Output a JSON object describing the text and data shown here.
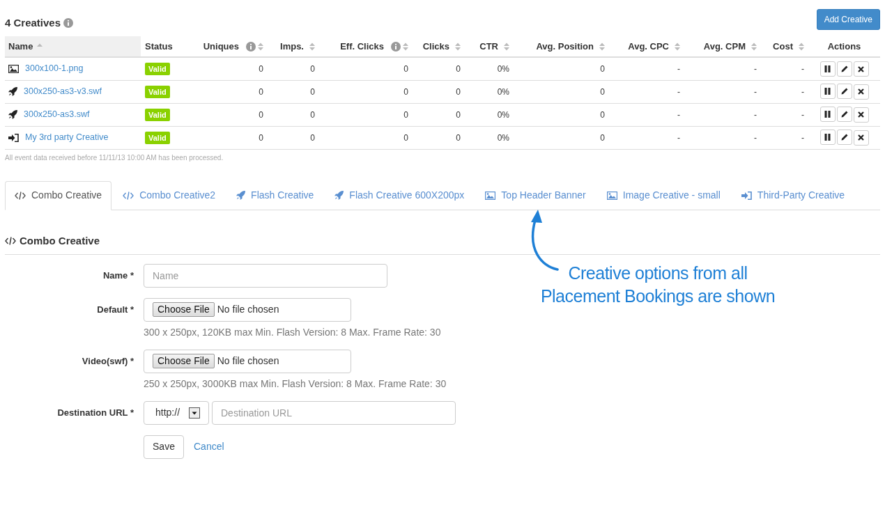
{
  "header": {
    "title": "4 Creatives",
    "info": true,
    "add_button": "Add Creative"
  },
  "table": {
    "columns": [
      {
        "label": "Name",
        "kind": "name",
        "sortable": true,
        "sorted": true,
        "info": false
      },
      {
        "label": "Status",
        "kind": "status",
        "sortable": false,
        "sorted": false,
        "info": false
      },
      {
        "label": "Uniques",
        "kind": "number",
        "sortable": true,
        "sorted": false,
        "info": true
      },
      {
        "label": "Imps.",
        "kind": "number",
        "sortable": true,
        "sorted": false,
        "info": false
      },
      {
        "label": "Eff. Clicks",
        "kind": "number",
        "sortable": true,
        "sorted": false,
        "info": true
      },
      {
        "label": "Clicks",
        "kind": "number",
        "sortable": true,
        "sorted": false,
        "info": false
      },
      {
        "label": "CTR",
        "kind": "number",
        "sortable": true,
        "sorted": false,
        "info": false
      },
      {
        "label": "Avg. Position",
        "kind": "number",
        "sortable": true,
        "sorted": false,
        "info": false
      },
      {
        "label": "Avg. CPC",
        "kind": "number",
        "sortable": true,
        "sorted": false,
        "info": false
      },
      {
        "label": "Avg. CPM",
        "kind": "number",
        "sortable": true,
        "sorted": false,
        "info": false
      },
      {
        "label": "Cost",
        "kind": "number",
        "sortable": true,
        "sorted": false,
        "info": false
      },
      {
        "label": "Actions",
        "kind": "actions",
        "sortable": false,
        "sorted": false,
        "info": false
      }
    ],
    "rows": [
      {
        "kind": "image",
        "name": "300x100-1.png",
        "status": "Valid",
        "values": [
          "0",
          "0",
          "0",
          "0",
          "0%",
          "0",
          "-",
          "-",
          "-"
        ]
      },
      {
        "kind": "flash",
        "name": "300x250-as3-v3.swf",
        "status": "Valid",
        "values": [
          "0",
          "0",
          "0",
          "0",
          "0%",
          "0",
          "-",
          "-",
          "-"
        ]
      },
      {
        "kind": "flash",
        "name": "300x250-as3.swf",
        "status": "Valid",
        "values": [
          "0",
          "0",
          "0",
          "0",
          "0%",
          "0",
          "-",
          "-",
          "-"
        ]
      },
      {
        "kind": "third_party",
        "name": "My 3rd party Creative",
        "status": "Valid",
        "values": [
          "0",
          "0",
          "0",
          "0",
          "0%",
          "0",
          "-",
          "-",
          "-"
        ]
      }
    ]
  },
  "note": "All event data received before 11/11/13 10:00 AM has been processed.",
  "tabs": [
    {
      "label": "Combo Creative",
      "kind": "combo",
      "selected": true
    },
    {
      "label": "Combo Creative2",
      "kind": "combo",
      "selected": false
    },
    {
      "label": "Flash Creative",
      "kind": "flash",
      "selected": false
    },
    {
      "label": "Flash Creative 600X200px",
      "kind": "flash",
      "selected": false
    },
    {
      "label": "Top Header Banner",
      "kind": "image",
      "selected": false
    },
    {
      "label": "Image Creative - small",
      "kind": "image",
      "selected": false
    },
    {
      "label": "Third-Party Creative",
      "kind": "third_party",
      "selected": false
    }
  ],
  "section": {
    "title": "Combo Creative",
    "kind": "combo"
  },
  "form": {
    "fields": [
      {
        "kind": "text",
        "label": "Name *",
        "placeholder": "Name"
      },
      {
        "kind": "file",
        "label": "Default *",
        "button": "Choose File",
        "value": "No file chosen",
        "help": "300 x 250px, 120KB max Min. Flash Version: 8 Max. Frame Rate: 30"
      },
      {
        "kind": "file",
        "label": "Video(swf) *",
        "button": "Choose File",
        "value": "No file chosen",
        "help": "250 x 250px, 3000KB max Min. Flash Version: 8 Max. Frame Rate: 30"
      },
      {
        "kind": "url",
        "label": "Destination URL *",
        "protocol": "http://",
        "placeholder": "Destination URL"
      }
    ],
    "save": "Save",
    "cancel": "Cancel"
  },
  "annotation": {
    "lines": [
      "Creative options from all",
      "Placement Bookings are shown"
    ]
  }
}
